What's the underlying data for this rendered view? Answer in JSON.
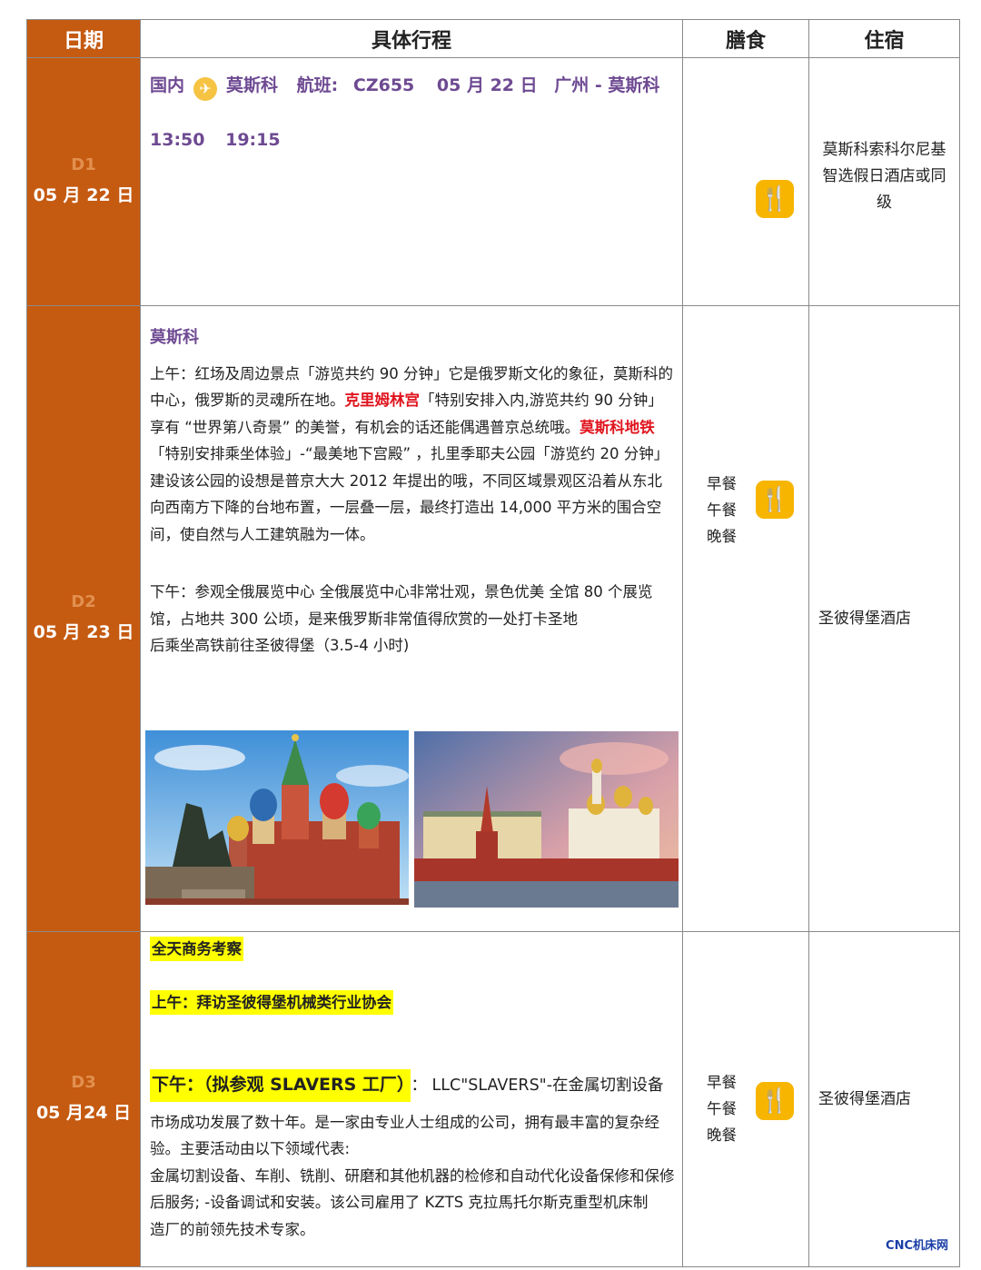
{
  "header": {
    "date": "日期",
    "itinerary": "具体行程",
    "meals": "膳食",
    "hotel": "住宿"
  },
  "days": [
    {
      "label": "D1",
      "date": "05 月 22 日",
      "flight_line1": {
        "region": "国内",
        "plane_icon": "airplane-icon",
        "dest": "莫斯科",
        "flight_label": "航班:",
        "flight_no": "CZ655",
        "fdate": "05 月 22 日",
        "route": "广州 - 莫斯科"
      },
      "flight_times": {
        "depart": "13:50",
        "arrive": "19:15"
      },
      "meals": [],
      "hotel": "莫斯科索科尔尼基智选假日酒店或同级"
    },
    {
      "label": "D2",
      "date": "05 月 23 日",
      "city": "莫斯科",
      "para1": [
        {
          "t": "上午：红场及周边景点「游览共约 90 分钟」它是俄罗斯文化的象征，莫斯科的中心，俄罗斯的灵魂所在地。"
        },
        {
          "t": "克里姆林宫",
          "red": true
        },
        {
          "t": "「特别安排入内,游览共约 90 分钟」享有 “世界第八奇景” 的美誉，有机会的话还能偶遇普京总统哦。"
        },
        {
          "t": "莫斯科地铁",
          "red": true
        },
        {
          "t": "「特别安排乘坐体验」-“最美地下宫殿” ，扎里季耶夫公园「游览约 20 分钟」建设该公园的设想是普京大大 2012 年提出的哦，不同区域景观区沿着从东北向西南方下降的台地布置，一层叠一层，最终打造出 14,000 平方米的围合空间，使自然与人工建筑融为一体。"
        }
      ],
      "para2_l1": "下午：参观全俄展览中心 全俄展览中心非常壮观，景色优美 全馆 80 个展览馆，占地共 300 公顷，是来俄罗斯非常值得欣赏的一处打卡圣地",
      "para2_l2": "后乘坐高铁前往圣彼得堡（3.5-4 小时)",
      "meals": [
        "早餐",
        "午餐",
        "晚餐"
      ],
      "hotel": "圣彼得堡酒店"
    },
    {
      "label": "D3",
      "date": "05 月24 日",
      "hl1": "全天商务考察",
      "hl2": "上午：拜访圣彼得堡机械类行业协会",
      "hl3": "下午：（拟参观 SLAVERS 工厂）",
      "after_hl3": "：  LLC\"SLAVERS\"-在金属切割设备",
      "para": "市场成功发展了数十年。是一家由专业人士组成的公司，拥有最丰富的复杂经验。主要活动由以下领域代表:",
      "para_l2": "金属切割设备、车削、铣削、研磨和其他机器的检修和自动代化设备保修和保修后服务; -设备调试和安装。该公司雇用了 KZTS 克拉馬托尔斯克重型机床制",
      "para_l3": "造厂的前领先技术专家。",
      "meals": [
        "早餐",
        "午餐",
        "晚餐"
      ],
      "hotel": "圣彼得堡酒店"
    }
  ],
  "icons": {
    "meal": "fork-knife-icon"
  },
  "watermark": "CNC机床网",
  "colors": {
    "date_column": "#c55a11",
    "flight_text": "#6e4a92",
    "highlight": "#ffff00",
    "meal_icon": "#f7b500",
    "attraction": "#e0141e"
  }
}
